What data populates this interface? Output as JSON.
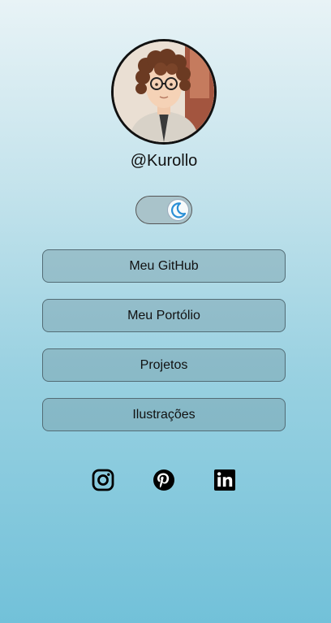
{
  "profile": {
    "username": "@Kurollo"
  },
  "theme_toggle": {
    "state": "dark-mode",
    "icon": "moon-icon"
  },
  "links": [
    {
      "label": "Meu GitHub"
    },
    {
      "label": "Meu Portólio"
    },
    {
      "label": "Projetos"
    },
    {
      "label": "Ilustrações"
    }
  ],
  "social": [
    {
      "icon": "instagram-icon"
    },
    {
      "icon": "pinterest-icon"
    },
    {
      "icon": "linkedin-icon"
    }
  ],
  "colors": {
    "background_top": "#e8f3f6",
    "background_bottom": "#72c1d9",
    "button_border": "#536c75",
    "moon_accent": "#2a8fd6"
  }
}
